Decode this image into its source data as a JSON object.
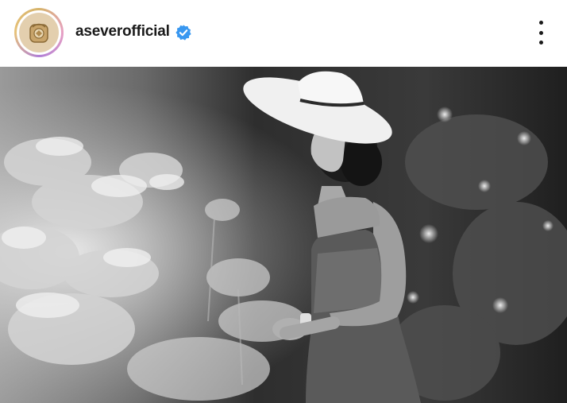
{
  "post": {
    "username": "aseverofficial",
    "verified": true,
    "verified_color": "#3897f0",
    "avatar_icon": "gold-crest-logo",
    "menu_icon": "more-vertical-icon",
    "photo_description_style": "black-and-white"
  }
}
